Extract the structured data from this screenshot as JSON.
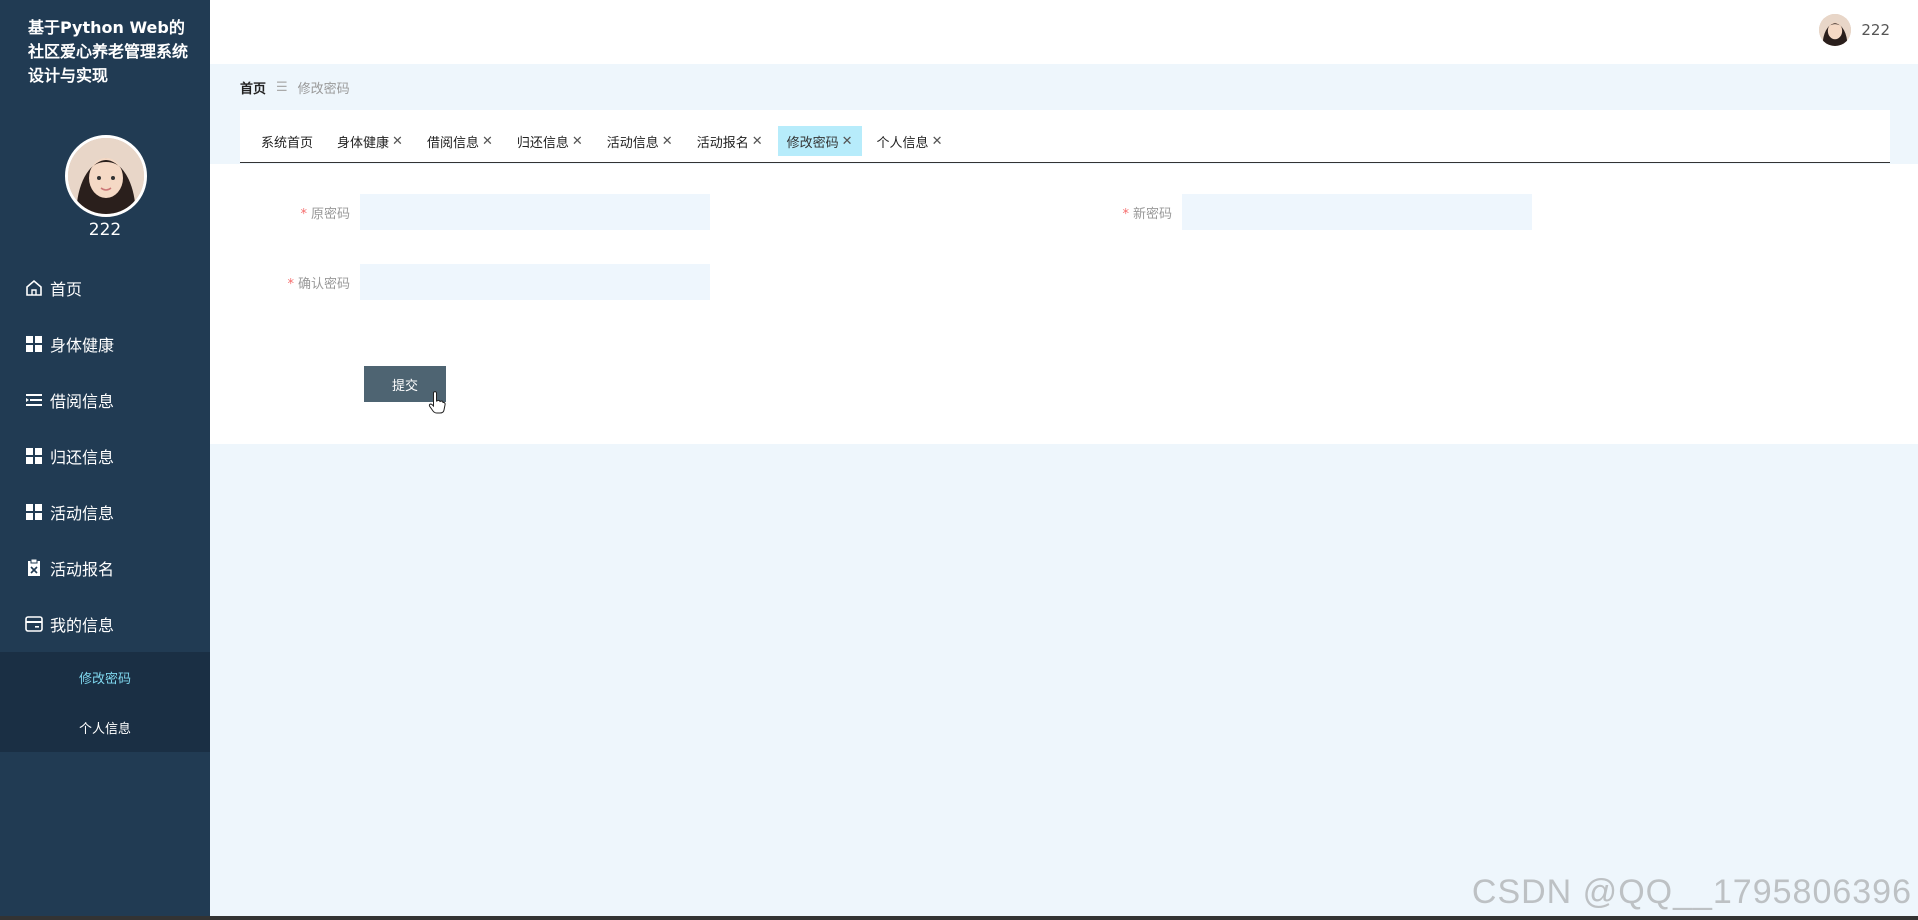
{
  "sidebar": {
    "title": "基于Python Web的社区爱心养老管理系统设计与实现",
    "username": "222",
    "menu": [
      {
        "label": "首页",
        "icon": "home-icon"
      },
      {
        "label": "身体健康",
        "icon": "grid-icon"
      },
      {
        "label": "借阅信息",
        "icon": "list-icon"
      },
      {
        "label": "归还信息",
        "icon": "grid-icon"
      },
      {
        "label": "活动信息",
        "icon": "grid-icon"
      },
      {
        "label": "活动报名",
        "icon": "clipboard-icon"
      },
      {
        "label": "我的信息",
        "icon": "card-icon"
      }
    ],
    "submenu": [
      {
        "label": "修改密码",
        "active": true
      },
      {
        "label": "个人信息",
        "active": false
      }
    ]
  },
  "header": {
    "username": "222"
  },
  "breadcrumb": {
    "home": "首页",
    "separator": "☰",
    "current": "修改密码"
  },
  "tabs": [
    {
      "label": "系统首页",
      "closable": false
    },
    {
      "label": "身体健康",
      "closable": true
    },
    {
      "label": "借阅信息",
      "closable": true
    },
    {
      "label": "归还信息",
      "closable": true
    },
    {
      "label": "活动信息",
      "closable": true
    },
    {
      "label": "活动报名",
      "closable": true
    },
    {
      "label": "修改密码",
      "closable": true,
      "active": true
    },
    {
      "label": "个人信息",
      "closable": true
    }
  ],
  "form": {
    "required_mark": "*",
    "old_password_label": "原密码",
    "new_password_label": "新密码",
    "confirm_password_label": "确认密码",
    "old_password_value": "",
    "new_password_value": "",
    "confirm_password_value": "",
    "submit_label": "提交"
  },
  "watermark": "CSDN @QQ__1795806396",
  "colors": {
    "sidebar_bg": "#213b53",
    "active_tab": "#b7ecfb",
    "button_bg": "#4e6472",
    "page_bg": "#eef6fc"
  }
}
